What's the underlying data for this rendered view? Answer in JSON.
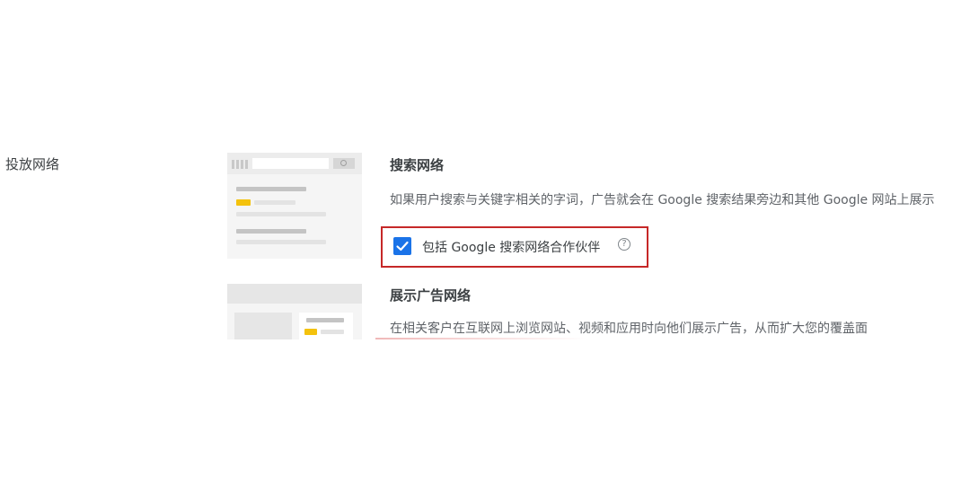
{
  "section": {
    "label": "投放网络"
  },
  "search_network": {
    "title": "搜索网络",
    "description": "如果用户搜索与关键字相关的字词，广告就会在 Google 搜索结果旁边和其他 Google 网站上展示",
    "checkbox": {
      "label": "包括 Google 搜索网络合作伙伴",
      "checked": true,
      "help_icon": "?"
    }
  },
  "display_network": {
    "title": "展示广告网络",
    "description": "在相关客户在互联网上浏览网站、视频和应用时向他们展示广告，从而扩大您的覆盖面"
  },
  "colors": {
    "checkbox_accent": "#1a73e8",
    "highlight_border": "#c62828",
    "illustration_accent": "#f4c20d"
  },
  "icons": {
    "checkbox": "check-icon",
    "help": "help-circle-icon"
  }
}
